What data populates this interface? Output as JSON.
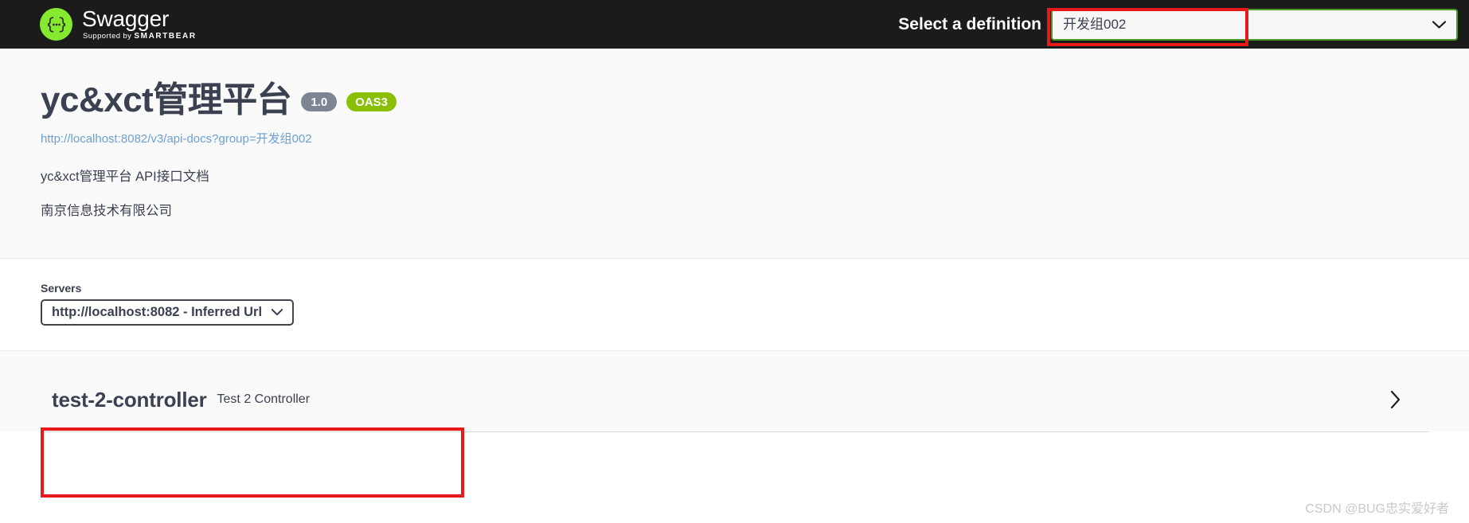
{
  "header": {
    "brand_name": "Swagger",
    "brand_supported_prefix": "Supported by",
    "brand_supported_company": "SMARTBEAR",
    "logo_icon": "swagger-braces-logo",
    "select_definition_label": "Select a definition",
    "definition_value": "开发组002",
    "definition_options": [
      "开发组002"
    ],
    "chevron_icon": "chevron-down-icon",
    "select_border_color": "#4c9a2a",
    "annotation_color": "#e8191b"
  },
  "info": {
    "title": "yc&xct管理平台",
    "version_badge": "1.0",
    "oas_badge": "OAS3",
    "version_badge_color": "#7d8492",
    "oas_badge_color": "#89bf04",
    "api_docs_url": "http://localhost:8082/v3/api-docs?group=开发组002",
    "description_line_1": "yc&xct管理平台 API接口文档",
    "description_line_2": "南京信息技术有限公司"
  },
  "servers": {
    "label": "Servers",
    "selected": "http://localhost:8082 - Inferred Url",
    "options": [
      "http://localhost:8082 - Inferred Url"
    ],
    "chevron_icon": "chevron-down-icon"
  },
  "tags": [
    {
      "name": "test-2-controller",
      "description": "Test 2 Controller",
      "expand_icon": "chevron-right-icon",
      "expanded": false
    }
  ],
  "watermark": {
    "text": "CSDN @BUG忠实爱好者"
  }
}
